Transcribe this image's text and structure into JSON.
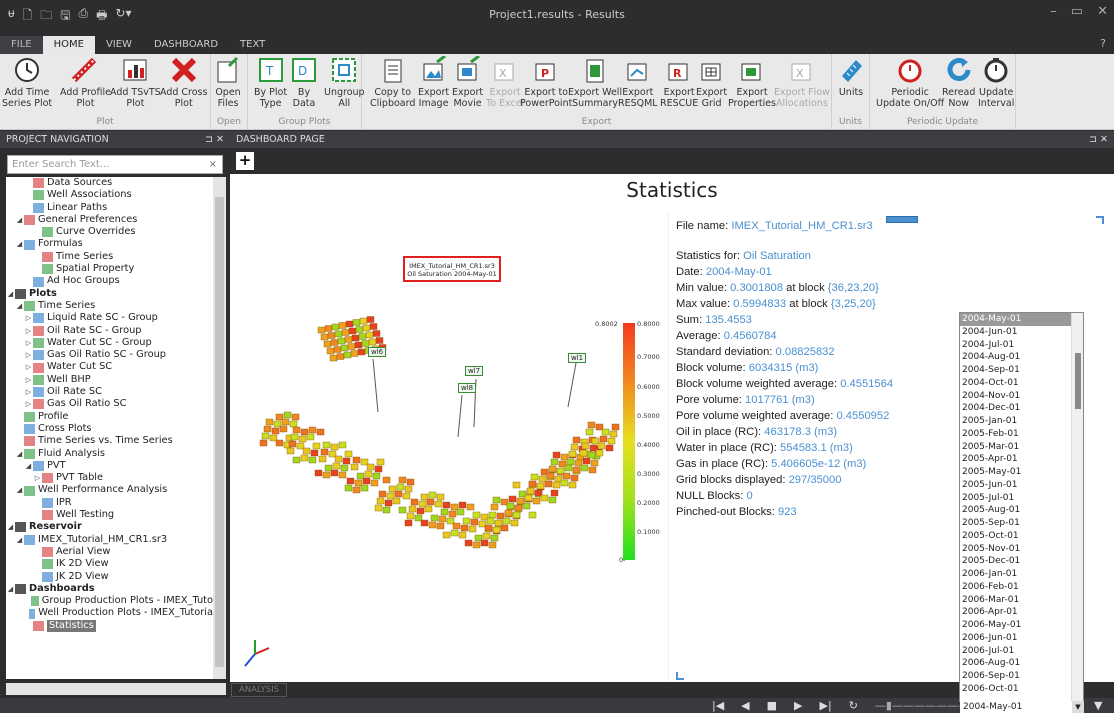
{
  "window": {
    "title": "Project1.results - Results",
    "controls": [
      "–",
      "▭",
      "✕"
    ]
  },
  "ribbon_tabs": [
    "FILE",
    "HOME",
    "VIEW",
    "DASHBOARD",
    "TEXT"
  ],
  "ribbon": {
    "groups": {
      "plot": "Plot",
      "open": "Open",
      "group_plots": "Group Plots",
      "export": "Export",
      "units": "Units",
      "periodic": "Periodic Update"
    },
    "buttons": {
      "add_time": [
        "Add Time",
        "Series Plot"
      ],
      "add_profile": [
        "Add Profile",
        "Plot"
      ],
      "add_tsvts": [
        "Add TSvTS",
        "Plot"
      ],
      "add_cross": [
        "Add Cross",
        "Plot"
      ],
      "open_files": [
        "Open",
        "Files"
      ],
      "by_plot_type": [
        "By Plot",
        "Type"
      ],
      "by_data": [
        "By",
        "Data"
      ],
      "ungroup_all": [
        "Ungroup",
        "All"
      ],
      "copy_clipboard": [
        "Copy to",
        "Clipboard"
      ],
      "export_image": [
        "Export",
        "Image"
      ],
      "export_movie": [
        "Export",
        "Movie"
      ],
      "export_excel": [
        "Export",
        "To Excel"
      ],
      "export_ppt": [
        "Export to",
        "PowerPoint"
      ],
      "export_well_summary": [
        "Export Well",
        "Summary"
      ],
      "export_resqml": [
        "Export",
        "RESQML"
      ],
      "export_rescue": [
        "Export",
        "RESCUE"
      ],
      "export_grid": [
        "Export",
        "Grid"
      ],
      "export_properties": [
        "Export",
        "Properties"
      ],
      "export_flow": [
        "Export Flow",
        "Allocations"
      ],
      "units": [
        "Units",
        ""
      ],
      "periodic_update": [
        "Periodic",
        "Update On/Off"
      ],
      "reread_now": [
        "Reread",
        "Now"
      ],
      "update_interval": [
        "Update",
        "Interval"
      ]
    }
  },
  "project_navigation": {
    "header": "PROJECT NAVIGATION",
    "pin": "⊐ ✕",
    "search_placeholder": "Enter Search Text...",
    "tree": [
      {
        "label": "Data Sources",
        "indent": 2,
        "bold": false
      },
      {
        "label": "Well Associations",
        "indent": 2,
        "bold": false
      },
      {
        "label": "Linear Paths",
        "indent": 2,
        "bold": false
      },
      {
        "label": "General Preferences",
        "indent": 1,
        "bold": false,
        "expander": "◢"
      },
      {
        "label": "Curve Overrides",
        "indent": 3,
        "bold": false
      },
      {
        "label": "Formulas",
        "indent": 1,
        "bold": false,
        "expander": "◢"
      },
      {
        "label": "Time Series",
        "indent": 3,
        "bold": false
      },
      {
        "label": "Spatial Property",
        "indent": 3,
        "bold": false
      },
      {
        "label": "Ad Hoc Groups",
        "indent": 2,
        "bold": false
      },
      {
        "label": "Plots",
        "indent": 0,
        "bold": true,
        "expander": "◢"
      },
      {
        "label": "Time Series",
        "indent": 1,
        "bold": false,
        "expander": "◢"
      },
      {
        "label": "Liquid Rate SC - Group",
        "indent": 2,
        "bold": false,
        "expander": "▷"
      },
      {
        "label": "Oil Rate SC - Group",
        "indent": 2,
        "bold": false,
        "expander": "▷"
      },
      {
        "label": "Water Cut SC - Group",
        "indent": 2,
        "bold": false,
        "expander": "▷"
      },
      {
        "label": "Gas Oil Ratio SC - Group",
        "indent": 2,
        "bold": false,
        "expander": "▷"
      },
      {
        "label": "Water Cut SC",
        "indent": 2,
        "bold": false,
        "expander": "▷"
      },
      {
        "label": "Well BHP",
        "indent": 2,
        "bold": false,
        "expander": "▷"
      },
      {
        "label": "Oil Rate SC",
        "indent": 2,
        "bold": false,
        "expander": "▷"
      },
      {
        "label": "Gas Oil Ratio SC",
        "indent": 2,
        "bold": false,
        "expander": "▷"
      },
      {
        "label": "Profile",
        "indent": 1,
        "bold": false
      },
      {
        "label": "Cross Plots",
        "indent": 1,
        "bold": false
      },
      {
        "label": "Time Series vs. Time Series",
        "indent": 1,
        "bold": false
      },
      {
        "label": "Fluid Analysis",
        "indent": 1,
        "bold": false,
        "expander": "◢"
      },
      {
        "label": "PVT",
        "indent": 2,
        "bold": false,
        "expander": "◢"
      },
      {
        "label": "PVT Table",
        "indent": 3,
        "bold": false,
        "expander": "▷"
      },
      {
        "label": "Well Performance Analysis",
        "indent": 1,
        "bold": false,
        "expander": "◢"
      },
      {
        "label": "IPR",
        "indent": 3,
        "bold": false
      },
      {
        "label": "Well Testing",
        "indent": 3,
        "bold": false
      },
      {
        "label": "Reservoir",
        "indent": 0,
        "bold": true,
        "expander": "◢"
      },
      {
        "label": "IMEX_Tutorial_HM_CR1.sr3",
        "indent": 1,
        "bold": false,
        "expander": "◢"
      },
      {
        "label": "Aerial View",
        "indent": 3,
        "bold": false
      },
      {
        "label": "IK 2D View",
        "indent": 3,
        "bold": false
      },
      {
        "label": "JK 2D View",
        "indent": 3,
        "bold": false
      },
      {
        "label": "Dashboards",
        "indent": 0,
        "bold": true,
        "expander": "◢"
      },
      {
        "label": "Group Production Plots - IMEX_Tuto",
        "indent": 2,
        "bold": false
      },
      {
        "label": "Well Production Plots - IMEX_Tutoria",
        "indent": 2,
        "bold": false
      },
      {
        "label": "Statistics",
        "indent": 2,
        "bold": false,
        "selected": true
      }
    ]
  },
  "dashboard": {
    "header": "DASHBOARD PAGE",
    "pin": "⊐ ✕",
    "add_label": "+",
    "title": "Statistics",
    "view3d": {
      "legend_line1": "IMEX_Tutorial_HM_CR1.sr3",
      "legend_line2": "Oil Saturation  2004-May-01",
      "colorbar_ticks": [
        "0.8002",
        "0.8000",
        "0.7000",
        "0.6000",
        "0.5000",
        "0.4000",
        "0.3000",
        "0.2000",
        "0.1000",
        "0-"
      ],
      "wells": [
        "wl6",
        "wl7",
        "wl8",
        "wl1"
      ]
    },
    "stats": {
      "file_name_label": "File name: ",
      "file_name": "IMEX_Tutorial_HM_CR1.sr3",
      "stats_for_label": "Statistics for: ",
      "stats_for": "Oil Saturation",
      "date_label": "Date: ",
      "date": "2004-May-01",
      "min_label": "Min value: ",
      "min": "0.3001808",
      "min_at": " at block ",
      "min_block": "{36,23,20}",
      "max_label": "Max value: ",
      "max": "0.5994833",
      "max_at": " at block ",
      "max_block": "{3,25,20}",
      "sum_label": "Sum: ",
      "sum": "135.4553",
      "avg_label": "Average: ",
      "avg": "0.4560784",
      "std_label": "Standard deviation: ",
      "std": "0.08825832",
      "bv_label": "Block volume: ",
      "bv": "6034315 (m3)",
      "bvwa_label": "Block volume weighted average: ",
      "bvwa": "0.4551564",
      "pv_label": "Pore volume: ",
      "pv": "1017761 (m3)",
      "pvwa_label": "Pore volume weighted average: ",
      "pvwa": "0.4550952",
      "oip_label": "Oil in place (RC): ",
      "oip": "463178.3 (m3)",
      "wip_label": "Water in place (RC): ",
      "wip": "554583.1 (m3)",
      "gip_label": "Gas in place (RC): ",
      "gip": "5.406605e-12 (m3)",
      "gbd_label": "Grid blocks displayed: ",
      "gbd": "297/35000",
      "null_label": "NULL Blocks: ",
      "null": "0",
      "pinched_label": "Pinched-out Blocks: ",
      "pinched": "923"
    },
    "analysis_tab": "ANALYSIS"
  },
  "date_dropdown": {
    "selected": "2004-May-01",
    "items": [
      "2004-May-01",
      "2004-Jun-01",
      "2004-Jul-01",
      "2004-Aug-01",
      "2004-Sep-01",
      "2004-Oct-01",
      "2004-Nov-01",
      "2004-Dec-01",
      "2005-Jan-01",
      "2005-Feb-01",
      "2005-Mar-01",
      "2005-Apr-01",
      "2005-May-01",
      "2005-Jun-01",
      "2005-Jul-01",
      "2005-Aug-01",
      "2005-Sep-01",
      "2005-Oct-01",
      "2005-Nov-01",
      "2005-Dec-01",
      "2006-Jan-01",
      "2006-Feb-01",
      "2006-Mar-01",
      "2006-Apr-01",
      "2006-May-01",
      "2006-Jun-01",
      "2006-Jul-01",
      "2006-Aug-01",
      "2006-Sep-01",
      "2006-Oct-01"
    ]
  },
  "player": {
    "buttons": [
      "|◀",
      "◀",
      "■",
      "▶",
      "▶|",
      "↻"
    ]
  },
  "colors": {
    "accent_value": "#4a90d0",
    "chrome": "#2d2d30",
    "ribbon": "#e9e9e9"
  }
}
